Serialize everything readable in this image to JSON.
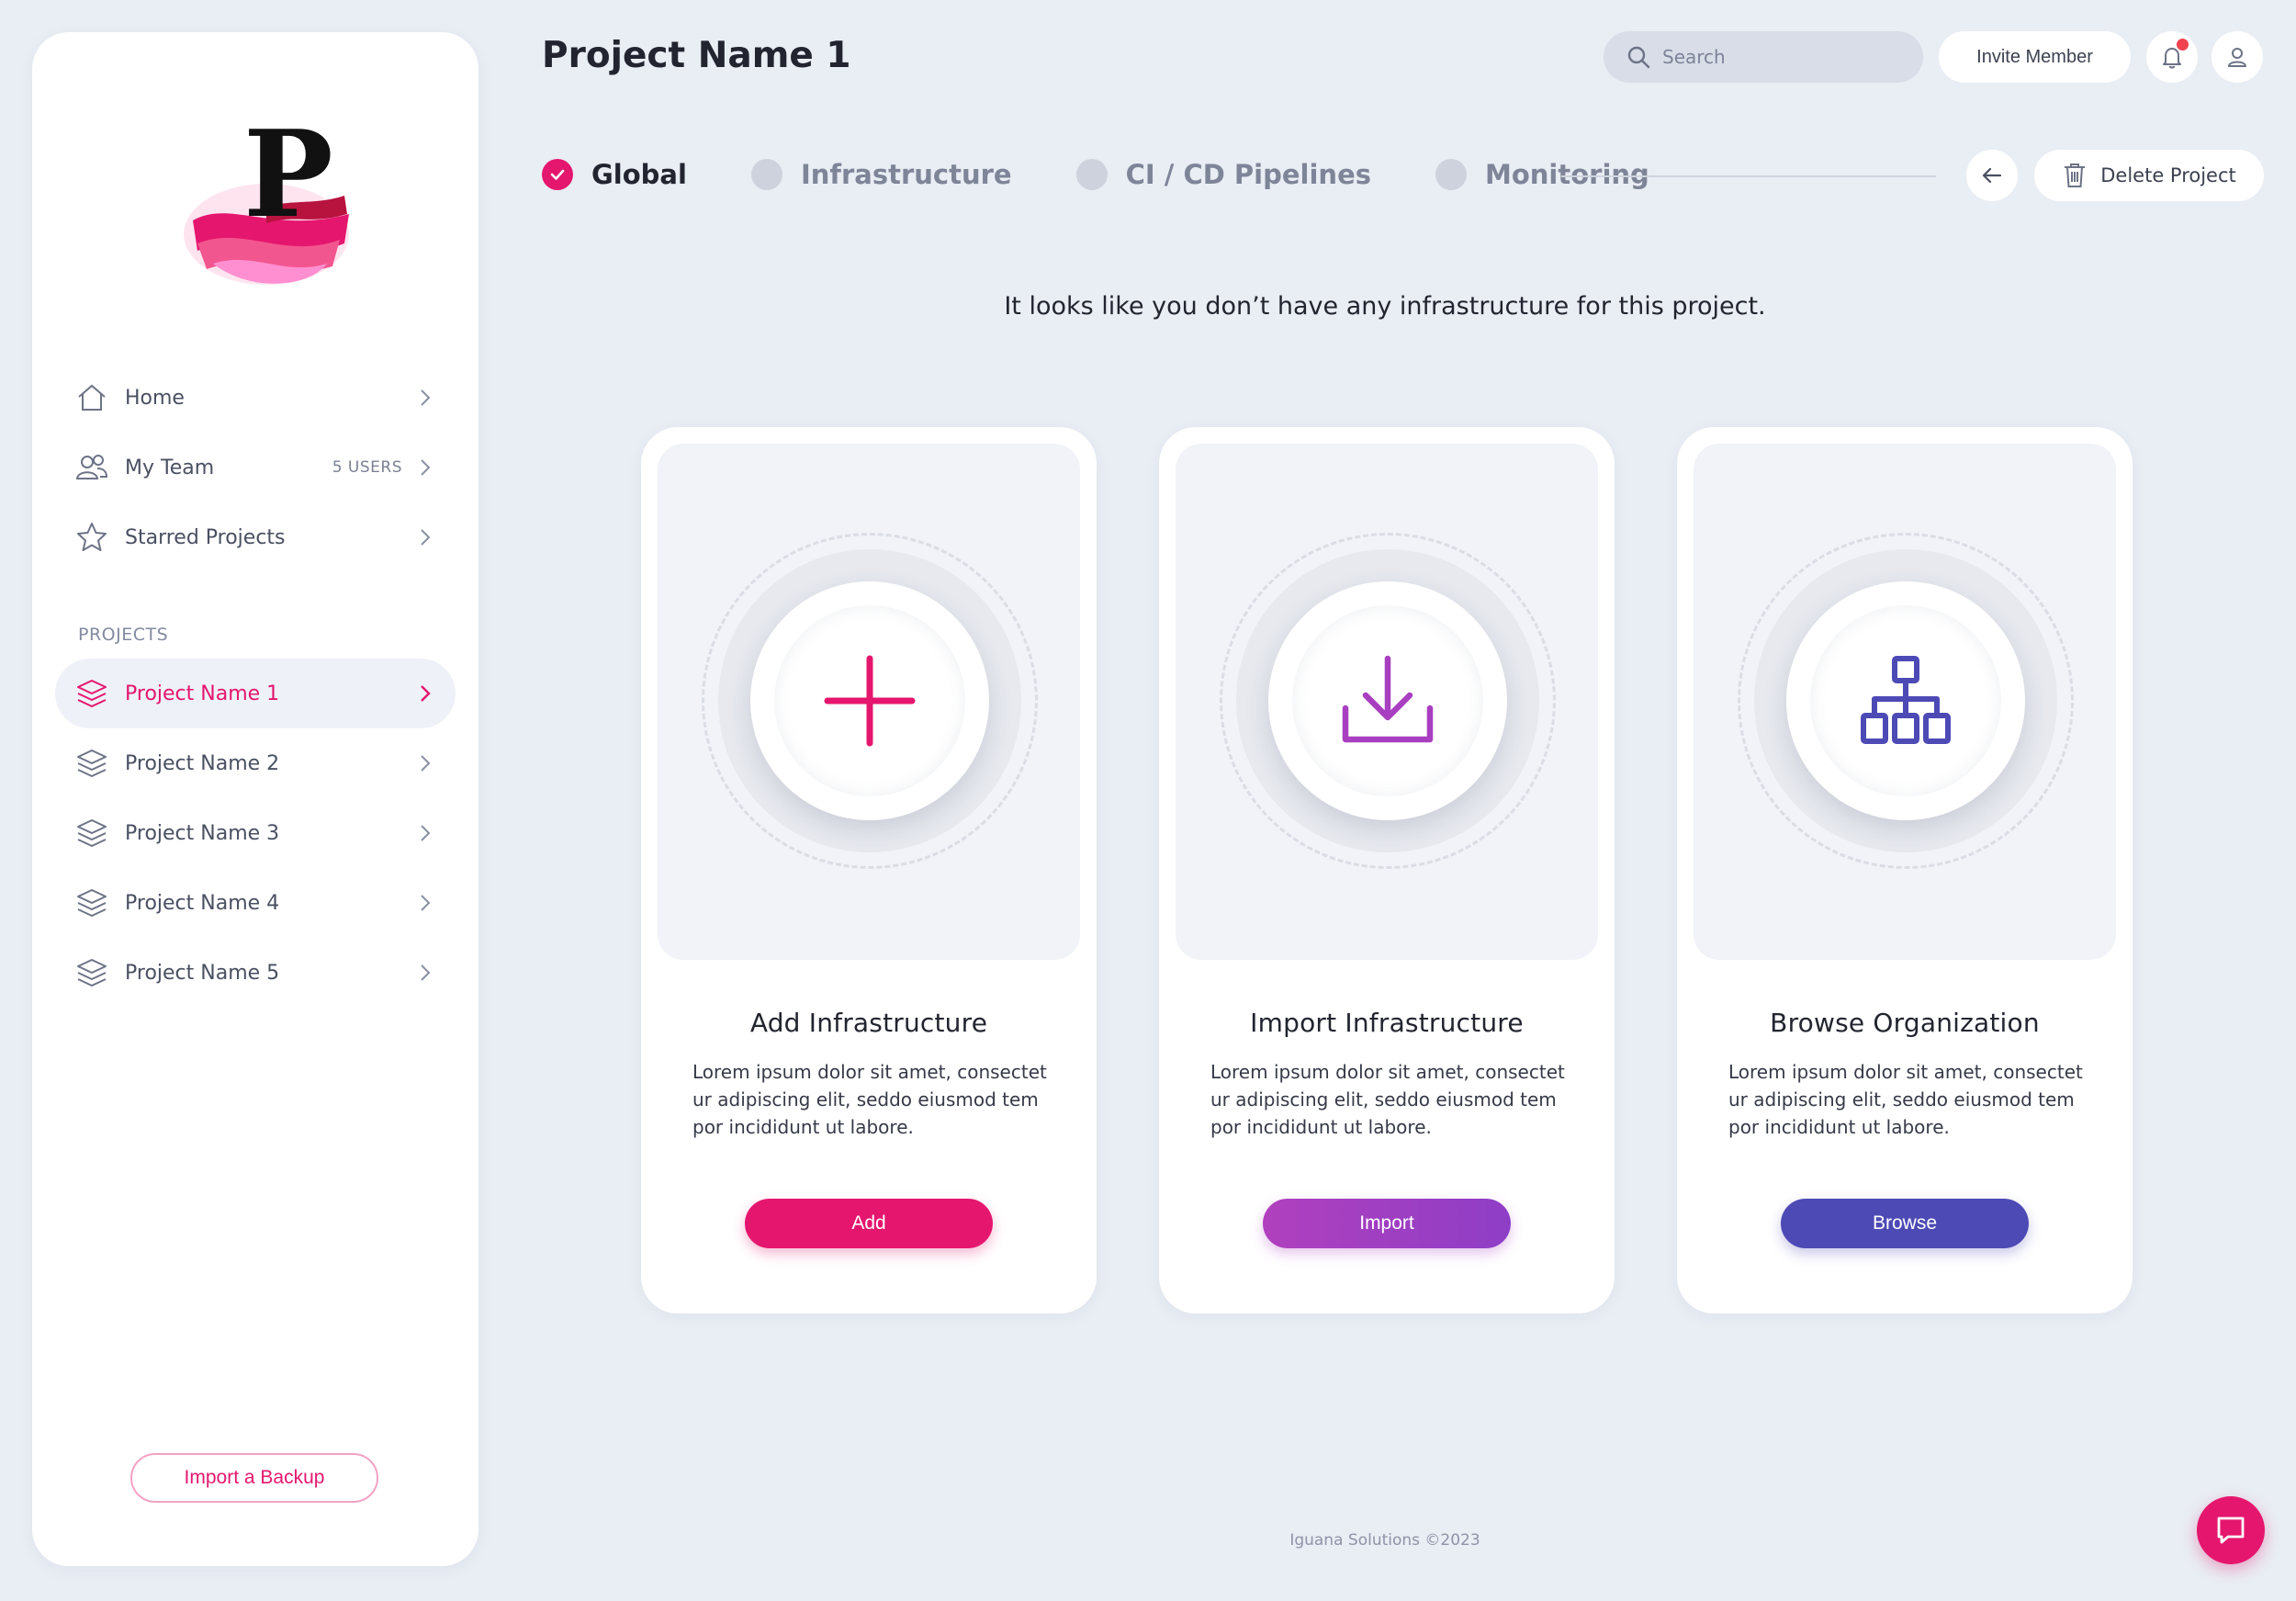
{
  "app": {
    "logo_icon": "p-wave-logo"
  },
  "sidebar": {
    "nav": [
      {
        "label": "Home",
        "icon": "home-icon",
        "meta": ""
      },
      {
        "label": "My Team",
        "icon": "team-icon",
        "meta": "5 USERS"
      },
      {
        "label": "Starred Projects",
        "icon": "star-icon",
        "meta": ""
      }
    ],
    "projects_section_label": "PROJECTS",
    "projects": [
      {
        "label": "Project Name 1",
        "active": true
      },
      {
        "label": "Project Name 2",
        "active": false
      },
      {
        "label": "Project Name 3",
        "active": false
      },
      {
        "label": "Project Name 4",
        "active": false
      },
      {
        "label": "Project Name 5",
        "active": false
      }
    ],
    "import_backup_label": "Import a Backup"
  },
  "header": {
    "title": "Project Name 1",
    "search_placeholder": "Search",
    "invite_label": "Invite Member",
    "has_notification": true
  },
  "tabs": [
    {
      "label": "Global",
      "active": true
    },
    {
      "label": "Infrastructure",
      "active": false
    },
    {
      "label": "CI / CD Pipelines",
      "active": false
    },
    {
      "label": "Monitoring",
      "active": false
    }
  ],
  "actions": {
    "delete_label": "Delete Project"
  },
  "main": {
    "empty_message": "It looks like you don’t have any infrastructure for this project.",
    "cards": [
      {
        "title": "Add Infrastructure",
        "text": "Lorem ipsum dolor sit amet, consectet ur adipiscing elit, seddo eiusmod tem por incididunt ut labore.",
        "button": "Add",
        "icon": "plus-icon",
        "color": "#e5166e"
      },
      {
        "title": "Import Infrastructure",
        "text": "Lorem ipsum dolor sit amet, consectet ur adipiscing elit, seddo eiusmod tem por incididunt ut labore.",
        "button": "Import",
        "icon": "download-icon",
        "color": "#a83fc0"
      },
      {
        "title": "Browse Organization",
        "text": "Lorem ipsum dolor sit amet, consectet ur adipiscing elit, seddo eiusmod tem por incididunt ut labore.",
        "button": "Browse",
        "icon": "org-chart-icon",
        "color": "#4d4ab5"
      }
    ]
  },
  "footer": {
    "text": "Iguana Solutions ©2023"
  },
  "colors": {
    "accent": "#e5166e",
    "import": "#a83fc0",
    "browse": "#4d4ab5",
    "background": "#e9edf4"
  }
}
